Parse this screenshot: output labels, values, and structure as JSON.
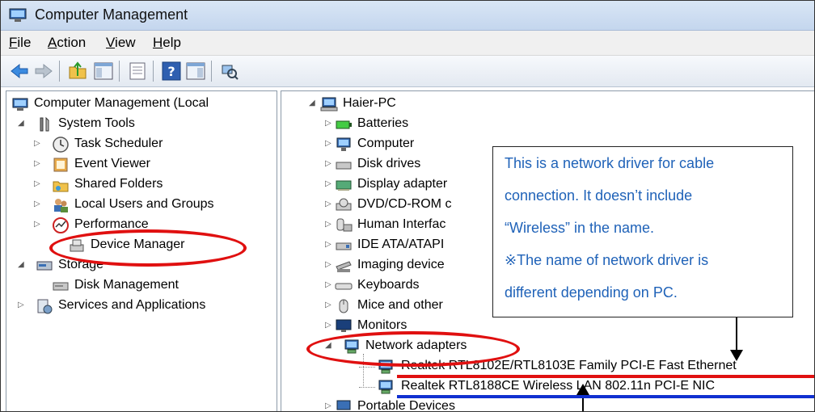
{
  "window": {
    "title": "Computer Management"
  },
  "menu": [
    "File",
    "Action",
    "View",
    "Help"
  ],
  "left_tree": {
    "root": "Computer Management (Local",
    "system_tools": "System Tools",
    "task_scheduler": "Task Scheduler",
    "event_viewer": "Event Viewer",
    "shared_folders": "Shared Folders",
    "local_users": "Local Users and Groups",
    "performance": "Performance",
    "device_manager": "Device Manager",
    "storage": "Storage",
    "disk_management": "Disk Management",
    "services": "Services and Applications"
  },
  "right_tree": {
    "root": "Haier-PC",
    "batteries": "Batteries",
    "computer": "Computer",
    "disk_drives": "Disk drives",
    "display": "Display adapter",
    "dvd": "DVD/CD-ROM c",
    "hid": "Human Interfac",
    "ide": "IDE ATA/ATAPI",
    "imaging": "Imaging device",
    "keyboards": "Keyboards",
    "mice": "Mice and other",
    "monitors": "Monitors",
    "network": "Network adapters",
    "nic1": "Realtek RTL8102E/RTL8103E Family PCI-E Fast Ethernet",
    "nic2": "Realtek RTL8188CE Wireless LAN 802.11n PCI-E NIC",
    "portable": "Portable Devices"
  },
  "callout": {
    "lines": [
      "This is a network driver for cable",
      "connection. It doesn’t include",
      "“Wireless” in the name.",
      "※The name of network driver is",
      "different depending on PC."
    ]
  },
  "colors": {
    "highlight_red": "#e01010",
    "highlight_blue": "#1030d0",
    "callout_text": "#1f62b8"
  }
}
